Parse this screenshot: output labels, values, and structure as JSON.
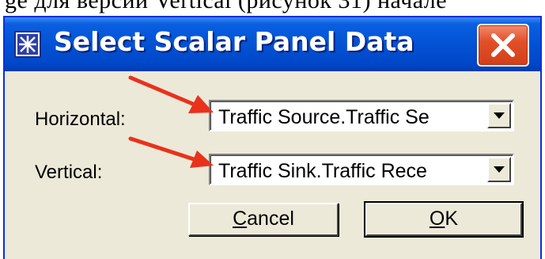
{
  "page_text_fragment": "ge для версии Vertical (рисунок 31) начале",
  "window": {
    "title": "Select Scalar Panel Data",
    "icon": "scalar-panel-app-icon",
    "close_icon": "close-x-icon"
  },
  "fields": [
    {
      "label": "Horizontal:",
      "value": "Traffic Source.Traffic Se"
    },
    {
      "label": "Vertical:",
      "value": "Traffic Sink.Traffic Rece"
    }
  ],
  "buttons": {
    "cancel": {
      "label_mnemonic": "C",
      "label_rest": "ancel"
    },
    "ok": {
      "label_mnemonic": "O",
      "label_rest": "K"
    }
  },
  "annotations": {
    "arrow_color": "#e8321c",
    "arrow_icon": "red-arrow-icon"
  },
  "colors": {
    "titlebar": "#0352d4",
    "dialog_face": "#ece9d8",
    "close_button": "#e2502a"
  }
}
